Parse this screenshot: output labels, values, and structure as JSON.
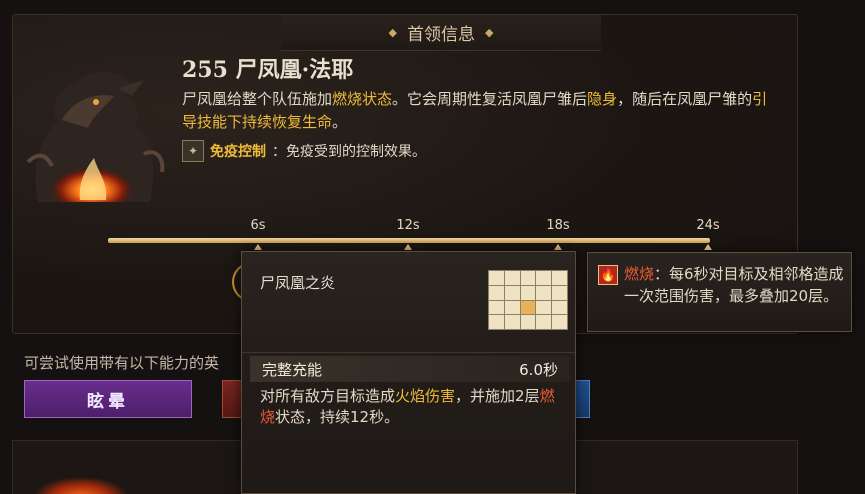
{
  "panel": {
    "title": "首领信息"
  },
  "boss": {
    "name": "255 尸凤凰·法耶",
    "desc_part1": "尸凤凰给整个队伍施加",
    "desc_hl1": "燃烧状态",
    "desc_part2": "。它会周期性复活凤凰尸雏后",
    "desc_hl2": "隐身",
    "desc_part3": "，随后在凤凰尸雏的",
    "desc_hl3": "引导技能下持续恢复生命",
    "desc_part4": "。"
  },
  "immunity": {
    "icon": "immune-icon",
    "label": "免疫控制",
    "text": "：免疫受到的控制效果。"
  },
  "timeline": {
    "ticks": [
      "6s",
      "12s",
      "18s",
      "24s"
    ]
  },
  "hint": {
    "text": "可尝试使用带有以下能力的英"
  },
  "abilities": {
    "stun_label": "眩晕"
  },
  "tooltip": {
    "title": "尸凤凰之炎",
    "charge_label": "完整充能",
    "charge_value": "6.0秒",
    "desc_part1": "对所有敌方目标造成",
    "desc_hl1": "火焰伤害",
    "desc_part2": "，并施加2层",
    "desc_hl2": "燃烧",
    "desc_part3": "状态，持续12秒。"
  },
  "debuff": {
    "icon": "fire-icon",
    "name": "燃烧",
    "text": "：每6秒对目标及相邻格造成一次范围伤害，最多叠加20层。"
  },
  "colors": {
    "highlight_gold": "#f0bb3a",
    "highlight_red": "#ec5a38",
    "timeline": "#f4d79a",
    "stun_button": "#6a2d8d"
  }
}
